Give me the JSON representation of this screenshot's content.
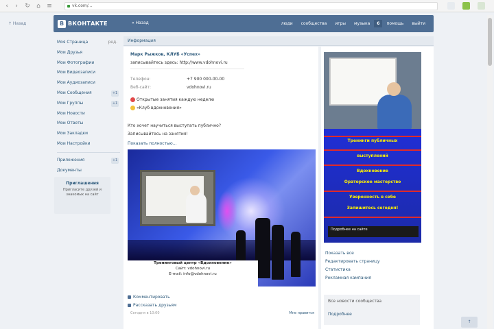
{
  "browser": {
    "url": "vk.com/..."
  },
  "header": {
    "logo_mark": "B",
    "logo_text": "ВКОНТАКТЕ",
    "back_label": "« Назад",
    "nav": [
      "люди",
      "сообщества",
      "игры",
      "музыка",
      "6",
      "помощь",
      "выйти"
    ]
  },
  "left_back": "↑ Назад",
  "sidebar": {
    "items": [
      {
        "label": "Моя Страница",
        "extra": "ред."
      },
      {
        "label": "Мои Друзья"
      },
      {
        "label": "Мои Фотографии"
      },
      {
        "label": "Мои Видеозаписи"
      },
      {
        "label": "Мои Аудиозаписи"
      },
      {
        "label": "Мои Сообщения",
        "count": "+1"
      },
      {
        "label": "Мои Группы",
        "count": "+1"
      },
      {
        "label": "Мои Новости"
      },
      {
        "label": "Мои Ответы"
      },
      {
        "label": "Мои Закладки"
      },
      {
        "label": "Мои Настройки"
      }
    ],
    "apps": [
      {
        "label": "Приложения",
        "count": "+1"
      },
      {
        "label": "Документы"
      }
    ],
    "promo": {
      "title": "Приглашения",
      "text": "Пригласите друзей и знакомых на сайт"
    }
  },
  "main": {
    "tab": "Информация",
    "profile": {
      "name": "Марк Рыжков, КЛУБ «Успех»",
      "status": "записывайтесь здесь: http://www.vdohnovi.ru"
    },
    "info": [
      {
        "label": "Телефон:",
        "value": "+7 900 000-00-00"
      },
      {
        "label": "Веб-сайт:",
        "value": "vdohnovi.ru"
      }
    ],
    "highlights": [
      "Открытые занятия каждую неделю",
      "«Клуб вдохновения»"
    ],
    "post": {
      "line1": "Кто хочет научиться выступать публично?",
      "line2": "Записывайтесь на занятия!",
      "link": "Показать полностью..."
    },
    "banner_caption": [
      "Тренинговый центр «Вдохновение»",
      "Сайт: vdohnovi.ru",
      "E-mail: info@vdohnovi.ru"
    ],
    "footer": [
      "Комментировать",
      "Рассказать друзьям"
    ],
    "post_date": "Сегодня в 10:00",
    "post_counter": "Мне нравится"
  },
  "right": {
    "ad_lines": [
      "Тренинги публичных",
      "выступлений",
      "Вдохновение",
      "Ораторское мастерство",
      "Уверенность в себе",
      "Запишитесь сегодня!"
    ],
    "ad_bar": "Подробнее на сайте",
    "links": [
      "Показать все",
      "Редактировать страницу",
      "Статистика",
      "Рекламная кампания"
    ],
    "box_text": "Все новости сообщества",
    "box_link": "Подробнее"
  },
  "corner_button": "↑"
}
